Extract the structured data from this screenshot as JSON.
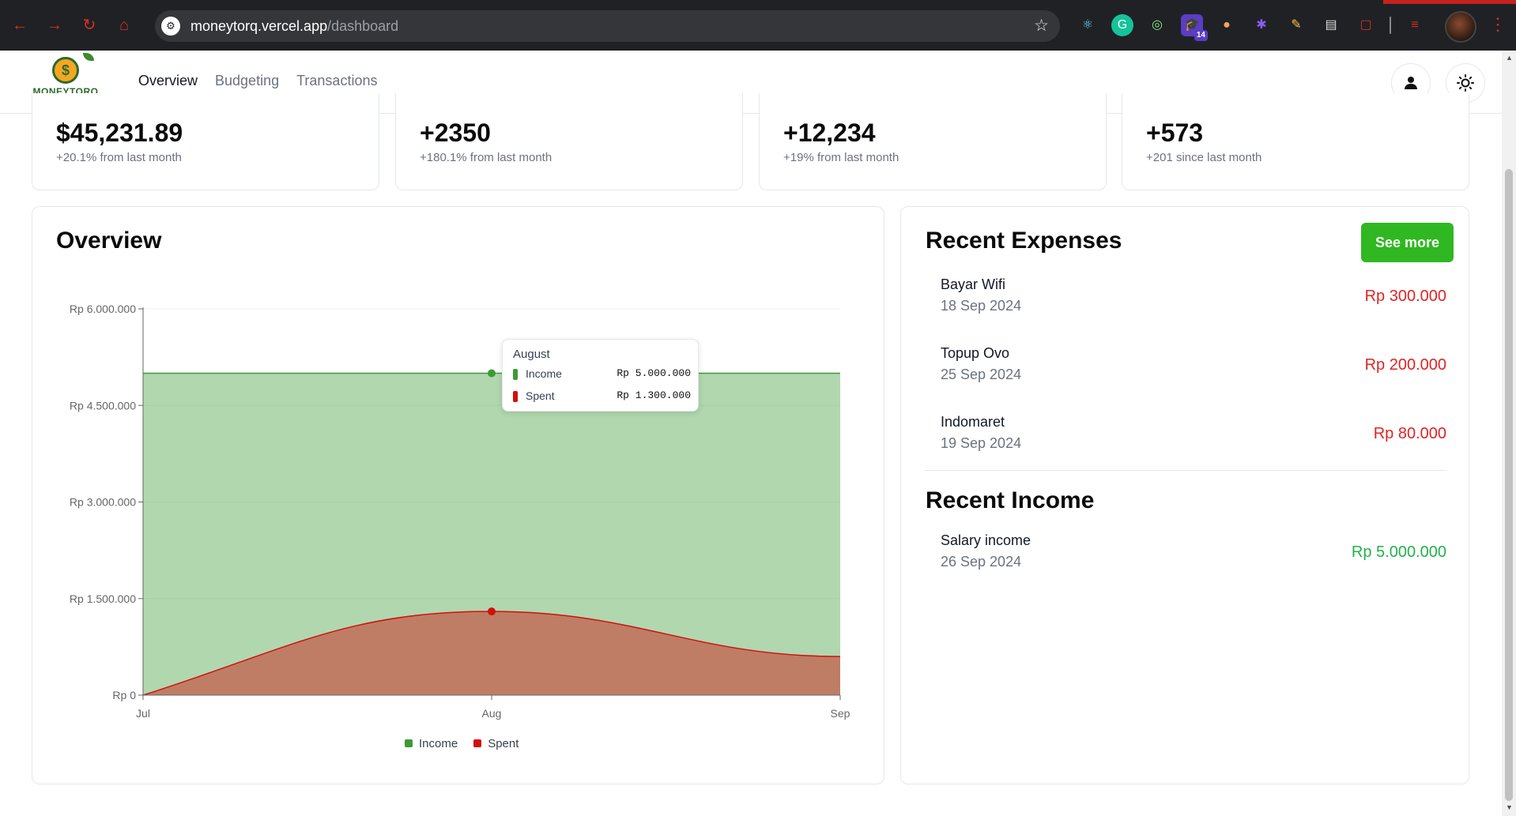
{
  "browser": {
    "url_host": "moneytorq.vercel.app",
    "url_path": "/dashboard",
    "extension_badge": "14"
  },
  "app": {
    "logo_text": "MONEYTORQ",
    "nav": [
      {
        "label": "Overview",
        "active": true
      },
      {
        "label": "Budgeting",
        "active": false
      },
      {
        "label": "Transactions",
        "active": false
      }
    ]
  },
  "stats": [
    {
      "value": "$45,231.89",
      "delta": "+20.1% from last month"
    },
    {
      "value": "+2350",
      "delta": "+180.1% from last month"
    },
    {
      "value": "+12,234",
      "delta": "+19% from last month"
    },
    {
      "value": "+573",
      "delta": "+201 since last month"
    }
  ],
  "overview": {
    "title": "Overview",
    "tooltip": {
      "title": "August",
      "rows": [
        {
          "label": "Income",
          "value": "Rp 5.000.000"
        },
        {
          "label": "Spent",
          "value": "Rp 1.300.000"
        }
      ]
    }
  },
  "chart_data": {
    "type": "area",
    "categories": [
      "Jul",
      "Aug",
      "Sep"
    ],
    "series": [
      {
        "name": "Income",
        "values": [
          5000000,
          5000000,
          5000000
        ],
        "color": "#3d9a35"
      },
      {
        "name": "Spent",
        "values": [
          0,
          1300000,
          600000
        ],
        "color": "#d10f0f"
      }
    ],
    "ylim": [
      0,
      6000000
    ],
    "yticks": [
      0,
      1500000,
      3000000,
      4500000,
      6000000
    ],
    "ytick_labels": [
      "Rp 0",
      "Rp 1.500.000",
      "Rp 3.000.000",
      "Rp 4.500.000",
      "Rp 6.000.000"
    ],
    "legend_position": "bottom",
    "title": "",
    "xlabel": "",
    "ylabel": ""
  },
  "recent_expenses": {
    "title": "Recent Expenses",
    "see_more_label": "See more",
    "items": [
      {
        "name": "Bayar Wifi",
        "date": "18 Sep 2024",
        "amount": "Rp 300.000"
      },
      {
        "name": "Topup Ovo",
        "date": "25 Sep 2024",
        "amount": "Rp 200.000"
      },
      {
        "name": "Indomaret",
        "date": "19 Sep 2024",
        "amount": "Rp 80.000"
      }
    ]
  },
  "recent_income": {
    "title": "Recent Income",
    "items": [
      {
        "name": "Salary income",
        "date": "26 Sep 2024",
        "amount": "Rp 5.000.000"
      }
    ]
  },
  "colors": {
    "expense": "#e02424",
    "income_text": "#22b14c",
    "primary_button": "#2fb821"
  }
}
